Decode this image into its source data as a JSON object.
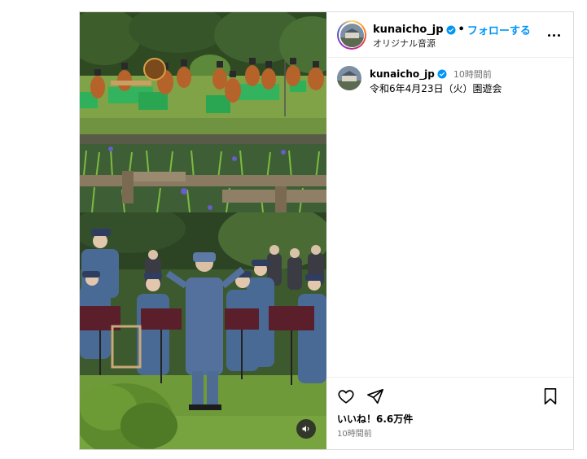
{
  "post": {
    "username": "kunaicho_jp",
    "follow_label": "フォローする",
    "separator": "•",
    "audio_label": "オリジナル音源",
    "caption_username": "kunaicho_jp",
    "caption_time": "10時間前",
    "caption_text": "令和6年4月23日（火）園遊会",
    "likes_text": "いいね！6.6万件",
    "time_ago": "10時間前"
  },
  "icons": {
    "verified": "verified-badge-icon",
    "more": "more-options-icon",
    "like": "heart-icon",
    "share": "paper-plane-icon",
    "save": "bookmark-icon",
    "sound": "speaker-icon"
  },
  "colors": {
    "accent": "#0095f6",
    "verified": "#0095f6",
    "muted": "#737373",
    "border": "#dbdbdb"
  }
}
